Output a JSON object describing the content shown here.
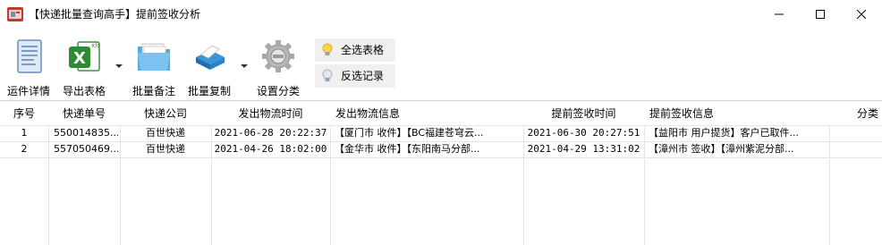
{
  "window": {
    "title": "【快递批量查询高手】提前签收分析"
  },
  "toolbar": {
    "buttons": [
      {
        "label": "运件详情",
        "icon": "document-icon"
      },
      {
        "label": "导出表格",
        "icon": "excel-icon"
      },
      {
        "label": "批量备注",
        "icon": "folder-icon"
      },
      {
        "label": "批量复制",
        "icon": "scanner-icon"
      },
      {
        "label": "设置分类",
        "icon": "gear-icon"
      }
    ],
    "side_buttons": [
      {
        "label": "全选表格",
        "icon": "lightbulb-icon"
      },
      {
        "label": "反选记录",
        "icon": "lightbulb-icon"
      }
    ]
  },
  "table": {
    "columns": [
      "序号",
      "快递单号",
      "快递公司",
      "发出物流时间",
      "发出物流信息",
      "提前签收时间",
      "提前签收信息",
      "分类"
    ],
    "rows": [
      [
        "1",
        "550014835...",
        "百世快递",
        "2021-06-28 20:22:37",
        "【厦门市 收件】【BC福建苍穹云...",
        "2021-06-30 20:27:51",
        "【益阳市 用户提货】客户已取件...",
        ""
      ],
      [
        "2",
        "557050469...",
        "百世快递",
        "2021-04-26 18:02:00",
        "【金华市 收件】【东阳南马分部...",
        "2021-04-29 13:31:02",
        "【漳州市 签收】【漳州紫泥分部...",
        ""
      ]
    ]
  }
}
